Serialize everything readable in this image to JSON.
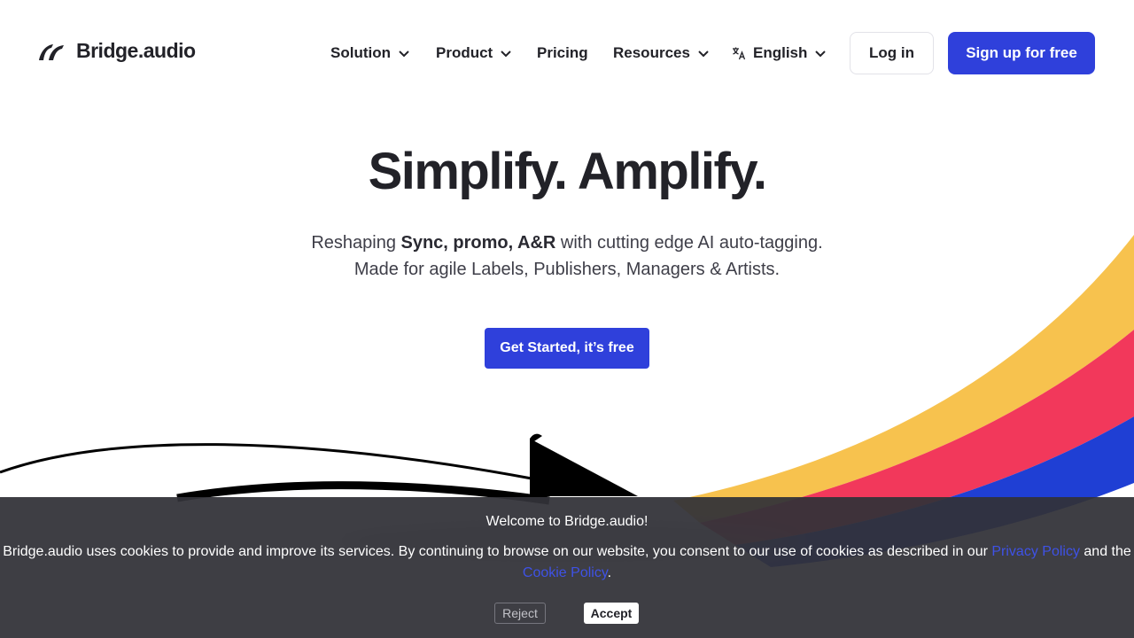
{
  "brand": {
    "name": "Bridge.audio",
    "primary_color": "#2f40db",
    "text_color": "#222228"
  },
  "nav": {
    "items": [
      {
        "label": "Solution",
        "has_dropdown": true
      },
      {
        "label": "Product",
        "has_dropdown": true
      },
      {
        "label": "Pricing",
        "has_dropdown": false
      },
      {
        "label": "Resources",
        "has_dropdown": true
      }
    ],
    "language": {
      "label": "English",
      "icon": "translate-icon"
    },
    "login_label": "Log in",
    "signup_label": "Sign up for free"
  },
  "hero": {
    "title": "Simplify. Amplify.",
    "subtitle_pre": "Reshaping ",
    "subtitle_bold": "Sync, promo, A&R",
    "subtitle_post": " with cutting edge AI auto-tagging.",
    "subtitle_line2": "Made for agile Labels, Publishers, Managers & Artists.",
    "cta_label": "Get Started, it’s free"
  },
  "art": {
    "stripe_colors": [
      "#f7c24e",
      "#f2385b",
      "#1f3fd4"
    ]
  },
  "cookie_banner": {
    "title": "Welcome to Bridge.audio!",
    "text_pre": "Bridge.audio uses cookies to provide and improve its services. By continuing to browse on our website, you consent to our use of cookies as described in our ",
    "privacy_link": "Privacy Policy",
    "text_mid": " and the ",
    "cookie_link": "Cookie Policy",
    "text_post": ".",
    "reject_label": "Reject",
    "accept_label": "Accept",
    "link_color": "#3e52e6"
  }
}
